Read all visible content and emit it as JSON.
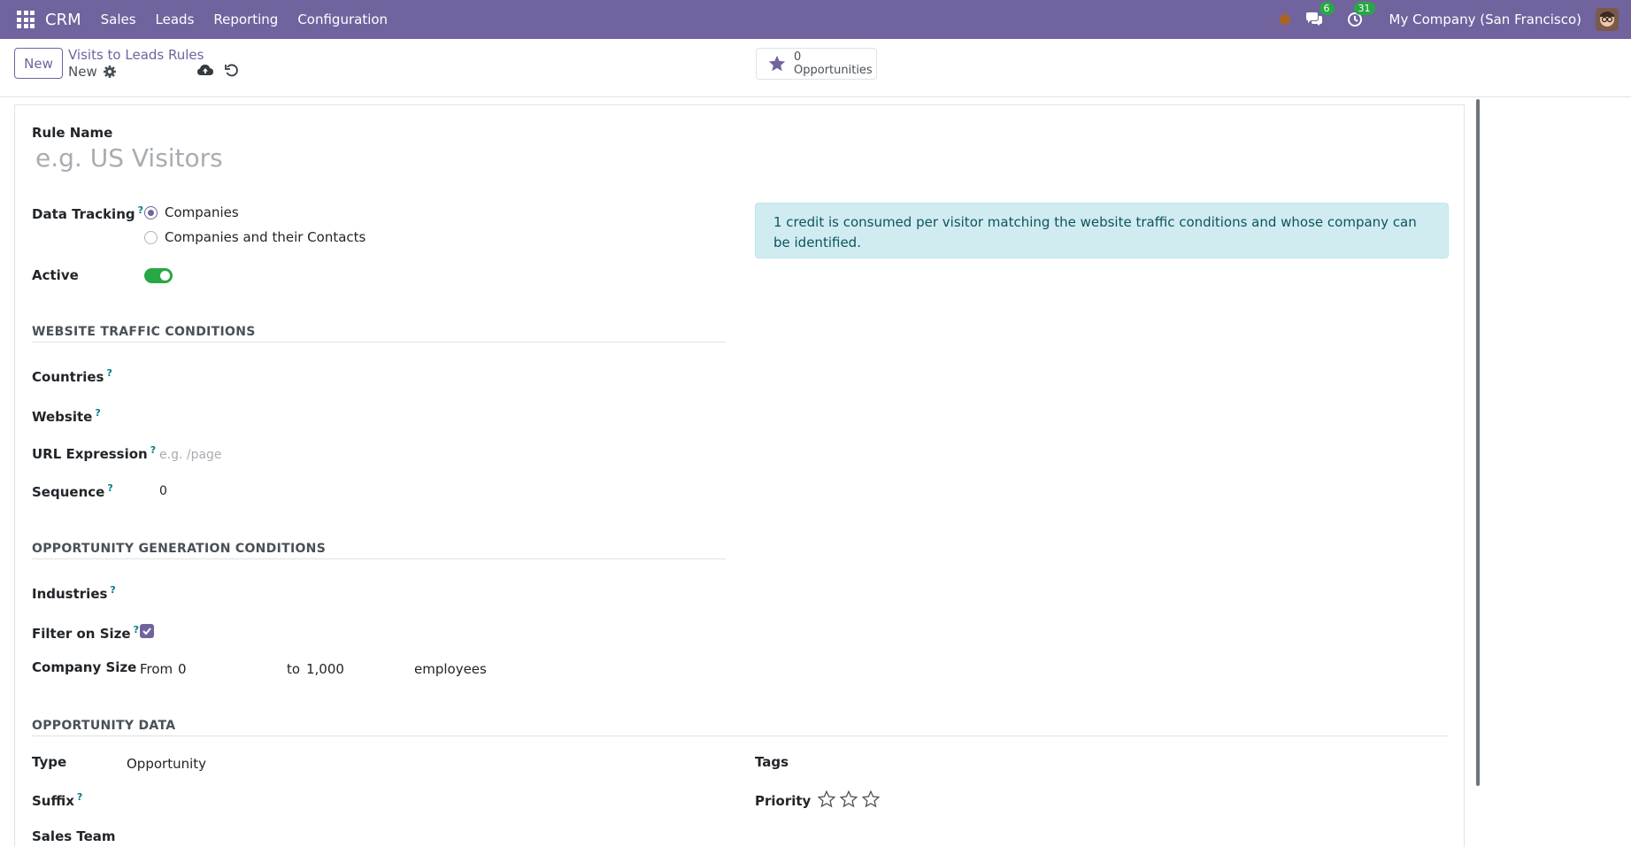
{
  "navbar": {
    "brand": "CRM",
    "menu": [
      "Sales",
      "Leads",
      "Reporting",
      "Configuration"
    ],
    "messages_count": "6",
    "activities_count": "31",
    "company": "My Company (San Francisco)"
  },
  "control": {
    "new_label": "New",
    "breadcrumb": "Visits to Leads Rules",
    "record_name": "New",
    "stat_count": "0",
    "stat_label": "Opportunities"
  },
  "form": {
    "rule_name_label": "Rule Name",
    "rule_name_placeholder": "e.g. US Visitors",
    "data_tracking_label": "Data Tracking",
    "data_tracking_options": [
      "Companies",
      "Companies and their Contacts"
    ],
    "data_tracking_selected": "Companies",
    "active_label": "Active",
    "active": true,
    "info_text": "1 credit is consumed per visitor matching the website traffic conditions and whose company can be identified.",
    "website_section": "WEBSITE TRAFFIC CONDITIONS",
    "countries_label": "Countries",
    "website_label": "Website",
    "url_label": "URL Expression",
    "url_placeholder": "e.g. /page",
    "sequence_label": "Sequence",
    "sequence_value": "0",
    "opp_gen_section": "OPPORTUNITY GENERATION CONDITIONS",
    "industries_label": "Industries",
    "filter_size_label": "Filter on Size",
    "filter_size_checked": true,
    "company_size_label": "Company Size",
    "from_label": "From",
    "from_value": "0",
    "to_label": "to",
    "to_value": "1,000",
    "employees_label": "employees",
    "opp_data_section": "OPPORTUNITY DATA",
    "type_label": "Type",
    "type_value": "Opportunity",
    "suffix_label": "Suffix",
    "sales_team_label": "Sales Team",
    "tags_label": "Tags",
    "priority_label": "Priority",
    "priority_stars": 0
  },
  "colors": {
    "brand": "#71639e",
    "success": "#28a745",
    "info_bg": "#d1ecf1",
    "info_text": "#0c5460"
  }
}
